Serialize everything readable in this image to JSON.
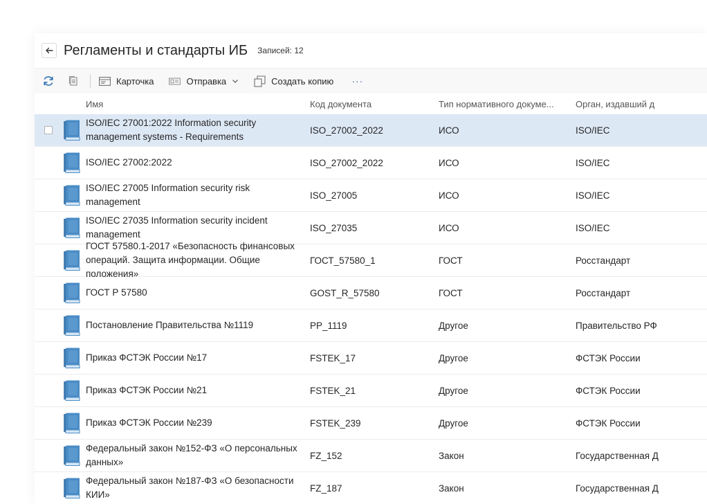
{
  "header": {
    "title": "Регламенты и стандарты ИБ",
    "count_label": "Записей: 12"
  },
  "toolbar": {
    "card_label": "Карточка",
    "send_label": "Отправка",
    "copy_label": "Создать копию",
    "more_label": "···"
  },
  "columns": {
    "name": "Имя",
    "code": "Код документа",
    "type": "Тип нормативного докуме...",
    "org": "Орган, издавший д"
  },
  "rows": [
    {
      "name": "ISO/IEC 27001:2022 Information security management systems - Requirements",
      "code": "ISO_27002_2022",
      "type": "ИСО",
      "org": "ISO/IEC"
    },
    {
      "name": "ISO/IEC 27002:2022",
      "code": "ISO_27002_2022",
      "type": "ИСО",
      "org": "ISO/IEC"
    },
    {
      "name": "ISO/IEC 27005 Information security risk management",
      "code": "ISO_27005",
      "type": "ИСО",
      "org": "ISO/IEC"
    },
    {
      "name": "ISO/IEC 27035 Information security incident management",
      "code": "ISO_27035",
      "type": "ИСО",
      "org": "ISO/IEC"
    },
    {
      "name": "ГОСТ 57580.1-2017 «Безопасность финансовых операций. Защита информации. Общие положения»",
      "code": "ГОСТ_57580_1",
      "type": "ГОСТ",
      "org": "Росстандарт"
    },
    {
      "name": "ГОСТ Р 57580",
      "code": "GOST_R_57580",
      "type": "ГОСТ",
      "org": "Росстандарт"
    },
    {
      "name": "Постановление Правительства №1119",
      "code": "PP_1119",
      "type": "Другое",
      "org": "Правительство РФ"
    },
    {
      "name": "Приказ ФСТЭК России №17",
      "code": "FSTEK_17",
      "type": "Другое",
      "org": "ФСТЭК России"
    },
    {
      "name": "Приказ ФСТЭК России №21",
      "code": "FSTEK_21",
      "type": "Другое",
      "org": "ФСТЭК России"
    },
    {
      "name": "Приказ ФСТЭК России №239",
      "code": "FSTEK_239",
      "type": "Другое",
      "org": "ФСТЭК России"
    },
    {
      "name": "Федеральный закон №152-ФЗ «О персональных данных»",
      "code": "FZ_152",
      "type": "Закон",
      "org": "Государственная Д"
    },
    {
      "name": "Федеральный закон №187-ФЗ «О безопасности КИИ»",
      "code": "FZ_187",
      "type": "Закон",
      "org": "Государственная Д"
    }
  ],
  "selected_row": 0,
  "colors": {
    "accent": "#3a78b5",
    "selected_bg": "#dde8f5",
    "book_icon": "#4a8cc6"
  },
  "icons": {
    "back": "arrow-left-icon",
    "refresh": "refresh-icon",
    "copy_doc": "copy-document-icon",
    "card": "card-icon",
    "send": "send-icon",
    "chevron": "chevron-down-icon",
    "create_copy": "duplicate-icon",
    "row_doc": "book-icon"
  }
}
